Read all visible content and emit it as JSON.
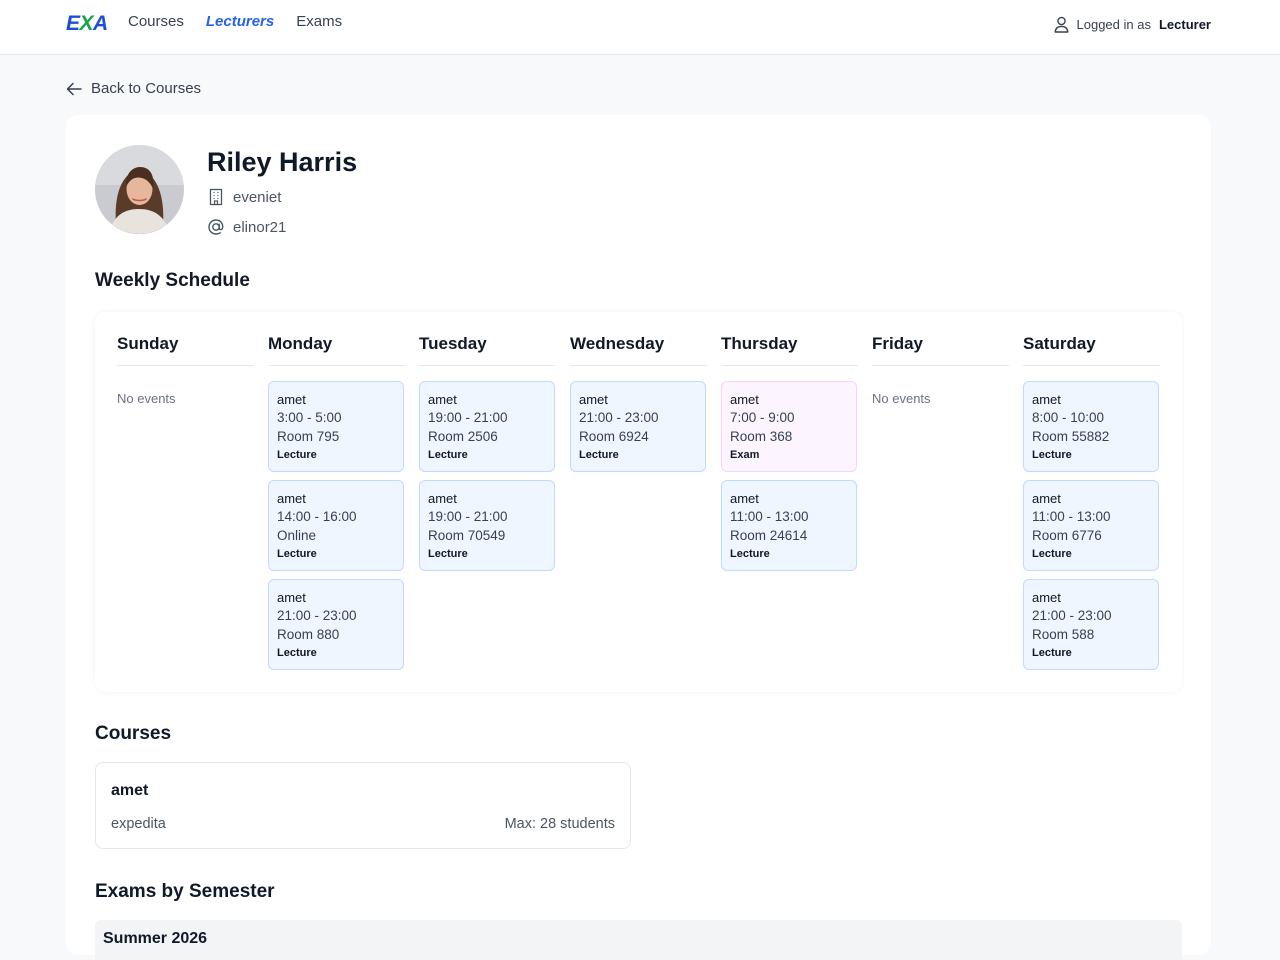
{
  "nav": {
    "logo": {
      "part1": "E",
      "part2": "X",
      "part3": "A"
    },
    "links": [
      "Courses",
      "Lecturers",
      "Exams"
    ],
    "active_link": "Lecturers",
    "user_prefix": "Logged in as",
    "user_role": "Lecturer"
  },
  "back_link": "Back to Courses",
  "profile": {
    "name": "Riley Harris",
    "department": "eveniet",
    "username": "elinor21"
  },
  "schedule": {
    "title": "Weekly Schedule",
    "no_events_label": "No events",
    "days": [
      {
        "name": "Sunday",
        "events": []
      },
      {
        "name": "Monday",
        "events": [
          {
            "title": "amet",
            "time": "3:00 - 5:00",
            "location": "Room 795",
            "type": "Lecture"
          },
          {
            "title": "amet",
            "time": "14:00 - 16:00",
            "location": "Online",
            "type": "Lecture"
          },
          {
            "title": "amet",
            "time": "21:00 - 23:00",
            "location": "Room 880",
            "type": "Lecture"
          }
        ]
      },
      {
        "name": "Tuesday",
        "events": [
          {
            "title": "amet",
            "time": "19:00 - 21:00",
            "location": "Room 2506",
            "type": "Lecture"
          },
          {
            "title": "amet",
            "time": "19:00 - 21:00",
            "location": "Room 70549",
            "type": "Lecture"
          }
        ]
      },
      {
        "name": "Wednesday",
        "events": [
          {
            "title": "amet",
            "time": "21:00 - 23:00",
            "location": "Room 6924",
            "type": "Lecture"
          }
        ]
      },
      {
        "name": "Thursday",
        "events": [
          {
            "title": "amet",
            "time": "7:00 - 9:00",
            "location": "Room 368",
            "type": "Exam"
          },
          {
            "title": "amet",
            "time": "11:00 - 13:00",
            "location": "Room 24614",
            "type": "Lecture"
          }
        ]
      },
      {
        "name": "Friday",
        "events": []
      },
      {
        "name": "Saturday",
        "events": [
          {
            "title": "amet",
            "time": "8:00 - 10:00",
            "location": "Room 55882",
            "type": "Lecture"
          },
          {
            "title": "amet",
            "time": "11:00 - 13:00",
            "location": "Room 6776",
            "type": "Lecture"
          },
          {
            "title": "amet",
            "time": "21:00 - 23:00",
            "location": "Room 588",
            "type": "Lecture"
          }
        ]
      }
    ]
  },
  "courses": {
    "title": "Courses",
    "items": [
      {
        "title": "amet",
        "description": "expedita",
        "max": "Max: 28 students"
      }
    ]
  },
  "exams": {
    "title": "Exams by Semester",
    "semesters": [
      "Summer 2026"
    ]
  },
  "colors": {
    "accent": "#2563eb",
    "lecture_bg": "#eff6ff",
    "lecture_border": "#bfdbfe",
    "exam_bg": "#fcf5ff",
    "exam_border": "#f0d7fa"
  }
}
